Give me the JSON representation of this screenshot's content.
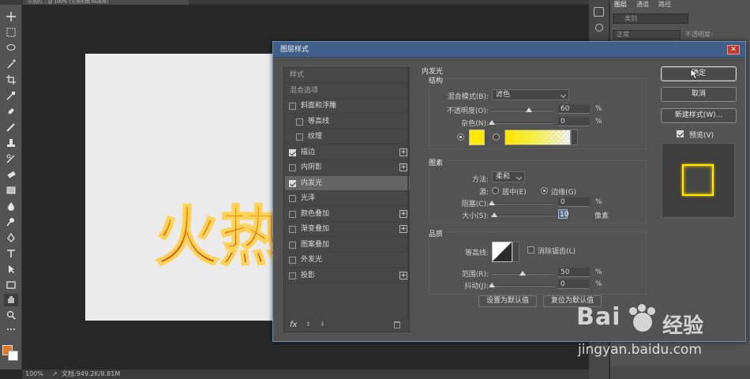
{
  "statusbar": {
    "zoom": "100%",
    "doc_info": "文档:949.2K/8.81M"
  },
  "doc_tab": {
    "title": "火热的... @ 100% (火热的图 RGB/8)"
  },
  "panels": {
    "tabs": [
      "图层",
      "通道",
      "路径"
    ],
    "filter_label": "类别",
    "blend": "正常",
    "opacity_label": "不透明度:"
  },
  "canvas_text": "火热",
  "dialog": {
    "title": "图层样式",
    "close": "✕",
    "style_list": [
      {
        "label": "样式",
        "type": "header",
        "checked": false,
        "plus": false
      },
      {
        "label": "混合选项",
        "type": "header",
        "checked": false,
        "plus": false
      },
      {
        "label": "斜面和浮雕",
        "type": "item",
        "checked": false,
        "plus": false
      },
      {
        "label": "等高线",
        "type": "sub",
        "checked": false,
        "plus": false
      },
      {
        "label": "纹理",
        "type": "sub",
        "checked": false,
        "plus": false
      },
      {
        "label": "描边",
        "type": "item",
        "checked": true,
        "plus": true
      },
      {
        "label": "内阴影",
        "type": "item",
        "checked": false,
        "plus": true
      },
      {
        "label": "内发光",
        "type": "item",
        "checked": true,
        "plus": false,
        "selected": true
      },
      {
        "label": "光泽",
        "type": "item",
        "checked": false,
        "plus": false
      },
      {
        "label": "颜色叠加",
        "type": "item",
        "checked": false,
        "plus": true
      },
      {
        "label": "渐变叠加",
        "type": "item",
        "checked": false,
        "plus": true
      },
      {
        "label": "图案叠加",
        "type": "item",
        "checked": false,
        "plus": false
      },
      {
        "label": "外发光",
        "type": "item",
        "checked": false,
        "plus": false
      },
      {
        "label": "投影",
        "type": "item",
        "checked": false,
        "plus": true
      }
    ],
    "footer": {
      "fx": "fx",
      "up": "⬆",
      "down": "⬇",
      "trash": "🗑"
    },
    "section_title": "内发光",
    "structure": {
      "title": "结构",
      "blend_mode_label": "混合模式(B):",
      "blend_mode_value": "滤色",
      "opacity_label": "不透明度(O):",
      "opacity_value": "60",
      "opacity_percent": 60,
      "noise_label": "杂色(N):",
      "noise_value": "0",
      "noise_percent": 0,
      "unit": "%",
      "color": "#ffea00"
    },
    "elements": {
      "title": "图素",
      "method_label": "方法:",
      "method_value": "柔和",
      "source_label": "源:",
      "source_center": "居中(E)",
      "source_edge": "边缘(G)",
      "choke_label": "阻塞(C):",
      "choke_value": "0",
      "choke_percent": 0,
      "size_label": "大小(S):",
      "size_value": "10",
      "size_percent": 4,
      "pct": "%",
      "px": "像素"
    },
    "quality": {
      "title": "品质",
      "contour_label": "等高线:",
      "antialias_label": "消除锯齿(L)",
      "range_label": "范围(R):",
      "range_value": "50",
      "range_percent": 50,
      "jitter_label": "抖动(J):",
      "jitter_value": "0",
      "jitter_percent": 0,
      "unit": "%"
    },
    "set_default": "设置为默认值",
    "reset_default": "复位为默认值",
    "buttons": {
      "ok": "确定",
      "cancel": "取消",
      "new_style": "新建样式(W)...",
      "preview": "预览(V)"
    }
  },
  "watermark": {
    "logo": "Bai",
    "logo2": "经验",
    "url": "jingyan.baidu.com"
  },
  "colors": {
    "title_bar": "#3f5f86",
    "glow": "#ffea00",
    "foreground": "#e87722"
  }
}
